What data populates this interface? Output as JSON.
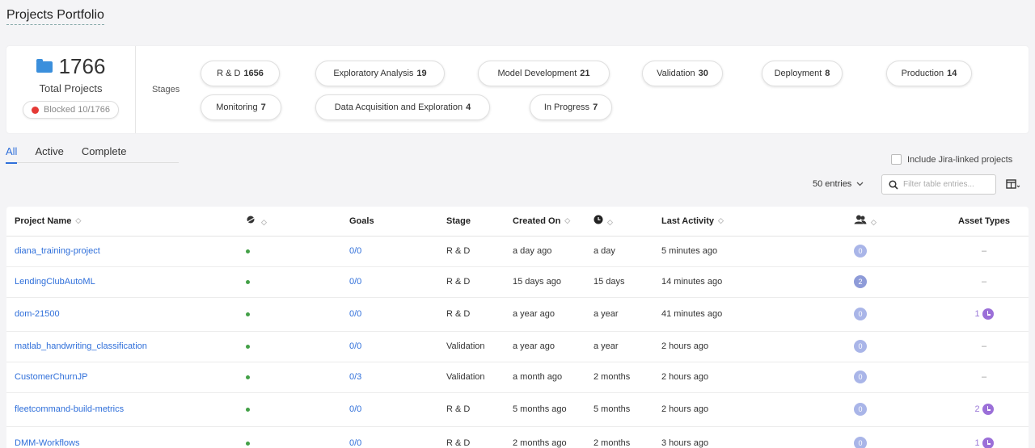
{
  "page": {
    "title": "Projects Portfolio"
  },
  "summary": {
    "total_count": "1766",
    "total_label": "Total Projects",
    "blocked": "Blocked 10/1766",
    "stages_label": "Stages",
    "stages": [
      {
        "name": "R & D",
        "count": "1656"
      },
      {
        "name": "Exploratory Analysis",
        "count": "19"
      },
      {
        "name": "Model Development",
        "count": "21"
      },
      {
        "name": "Validation",
        "count": "30"
      },
      {
        "name": "Deployment",
        "count": "8"
      },
      {
        "name": "Production",
        "count": "14"
      },
      {
        "name": "Monitoring",
        "count": "7"
      },
      {
        "name": "Data Acquisition and Exploration",
        "count": "4"
      },
      {
        "name": "In Progress",
        "count": "7"
      }
    ]
  },
  "tabs": [
    {
      "label": "All",
      "active": true
    },
    {
      "label": "Active",
      "active": false
    },
    {
      "label": "Complete",
      "active": false
    }
  ],
  "controls": {
    "jira_label": "Include Jira-linked projects",
    "entries_label": "50 entries",
    "filter_placeholder": "Filter table entries..."
  },
  "table": {
    "headers": {
      "project_name": "Project Name",
      "goals": "Goals",
      "stage": "Stage",
      "created_on": "Created On",
      "last_activity": "Last Activity",
      "asset_types": "Asset Types"
    },
    "rows": [
      {
        "name": "diana_training-project",
        "goals": "0/0",
        "stage": "R & D",
        "created": "a day ago",
        "duration": "a day",
        "last_activity": "5 minutes ago",
        "collaborators": "0",
        "assets": "–"
      },
      {
        "name": "LendingClubAutoML",
        "goals": "0/0",
        "stage": "R & D",
        "created": "15 days ago",
        "duration": "15 days",
        "last_activity": "14 minutes ago",
        "collaborators": "2",
        "assets": "–"
      },
      {
        "name": "dom-21500",
        "goals": "0/0",
        "stage": "R & D",
        "created": "a year ago",
        "duration": "a year",
        "last_activity": "41 minutes ago",
        "collaborators": "0",
        "assets": "1"
      },
      {
        "name": "matlab_handwriting_classification",
        "goals": "0/0",
        "stage": "Validation",
        "created": "a year ago",
        "duration": "a year",
        "last_activity": "2 hours ago",
        "collaborators": "0",
        "assets": "–"
      },
      {
        "name": "CustomerChurnJP",
        "goals": "0/3",
        "stage": "Validation",
        "created": "a month ago",
        "duration": "2 months",
        "last_activity": "2 hours ago",
        "collaborators": "0",
        "assets": "–"
      },
      {
        "name": "fleetcommand-build-metrics",
        "goals": "0/0",
        "stage": "R & D",
        "created": "5 months ago",
        "duration": "5 months",
        "last_activity": "2 hours ago",
        "collaborators": "0",
        "assets": "2"
      },
      {
        "name": "DMM-Workflows",
        "goals": "0/0",
        "stage": "R & D",
        "created": "2 months ago",
        "duration": "2 months",
        "last_activity": "3 hours ago",
        "collaborators": "0",
        "assets": "1"
      }
    ]
  }
}
